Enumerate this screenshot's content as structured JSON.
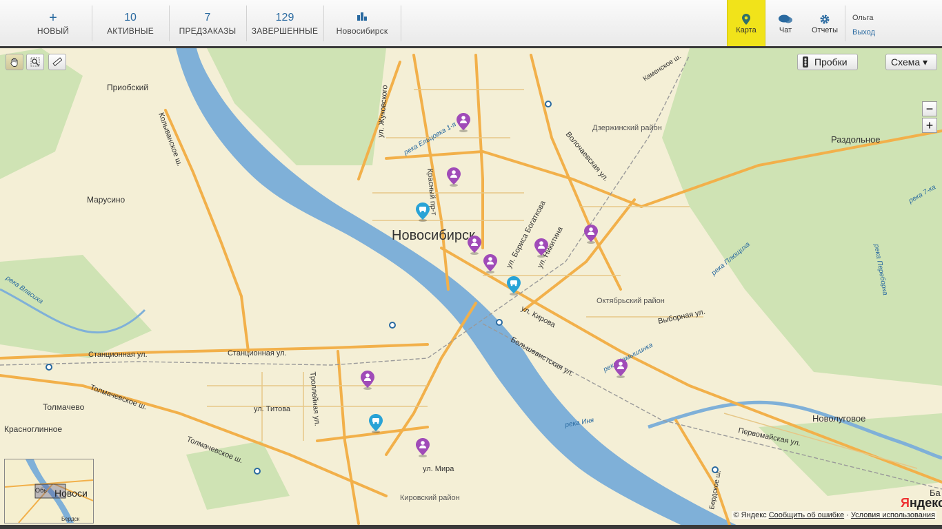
{
  "nav": {
    "new": {
      "icon": "plus-icon",
      "label": "НОВЫЙ"
    },
    "active": {
      "count": "10",
      "label": "АКТИВНЫЕ"
    },
    "preorders": {
      "count": "7",
      "label": "ПРЕДЗАКАЗЫ"
    },
    "completed": {
      "count": "129",
      "label": "ЗАВЕРШЕННЫЕ"
    },
    "city": {
      "icon": "buildings-icon",
      "label": "Новосибирск"
    }
  },
  "right_nav": {
    "map": {
      "icon": "map-pin-icon",
      "label": "Карта"
    },
    "chat": {
      "icon": "chat-bubbles-icon",
      "label": "Чат"
    },
    "reports": {
      "icon": "gear-icon",
      "label": "Отчеты"
    }
  },
  "user": {
    "name": "Ольга",
    "logout": "Выход"
  },
  "map_controls": {
    "traffic_label": "Пробки",
    "layer_label": "Схема ▾",
    "zoom_out": "−",
    "zoom_in": "+"
  },
  "colors": {
    "accent": "#f1e31a",
    "link": "#2a6aa0",
    "road": "#f2b04a",
    "water": "#7fb0d8",
    "park": "#cfe3b4",
    "marker_driver": "#a04bb8",
    "marker_car": "#29a3d6"
  },
  "map_labels": {
    "city": "Новосибирск",
    "priobsky": "Приобский",
    "marusino": "Марусино",
    "tolmachevo": "Толмачево",
    "krasnoglinnoe": "Красноглинное",
    "razdolnoe": "Раздольное",
    "novolugovoe": "Новолуговое",
    "dzerzhinsky": "Дзержинский район",
    "oktyabrsky": "Октябрьский район",
    "kirovsky": "Кировский район",
    "stantsionnaya": "Станционная ул.",
    "stantsionnaya2": "Станционная ул.",
    "tolmachevskaya": "Толмачевское ш.",
    "tolmachevskaya2": "Толмачевское ш.",
    "titova": "ул. Титова",
    "troleinaya": "Троллейная ул.",
    "mira": "ул. Мира",
    "kirova": "ул. Кирова",
    "bolshevistskaya": "Большевистская ул.",
    "vybornaya": "Выборная ул.",
    "pervomayskaya": "Первомайская ул.",
    "volochaevskaya": "Волочаевская ул.",
    "nikitina": "ул. Никитина",
    "bogatkova": "ул. Бориса Богаткова",
    "krasny": "Красный пр-т",
    "zhukovskogo": "ул. Жуковского",
    "kolyvanskoe": "Колыванское ш.",
    "kamenskoe": "Каменское ш.",
    "berdskoe": "Бердское ш.",
    "elcovka": "река Ельцовка 1-я",
    "plyushchikha": "река Плющиха",
    "kamyshinka": "река Камышинка",
    "inya": "река Иня",
    "vlasikha": "река Власиха",
    "perebornka": "река Переборка",
    "r7ka": "река 7-ка",
    "ba": "Ба"
  },
  "minimap": {
    "label_ob": "Обь",
    "label_city": "Новоси",
    "label_berdsk": "Бердск"
  },
  "footer": {
    "copyright": "© Яндекс",
    "report_error": "Сообщить об ошибке",
    "terms": "Условия использования"
  },
  "logo": {
    "first": "Я",
    "rest": "ндекс"
  }
}
